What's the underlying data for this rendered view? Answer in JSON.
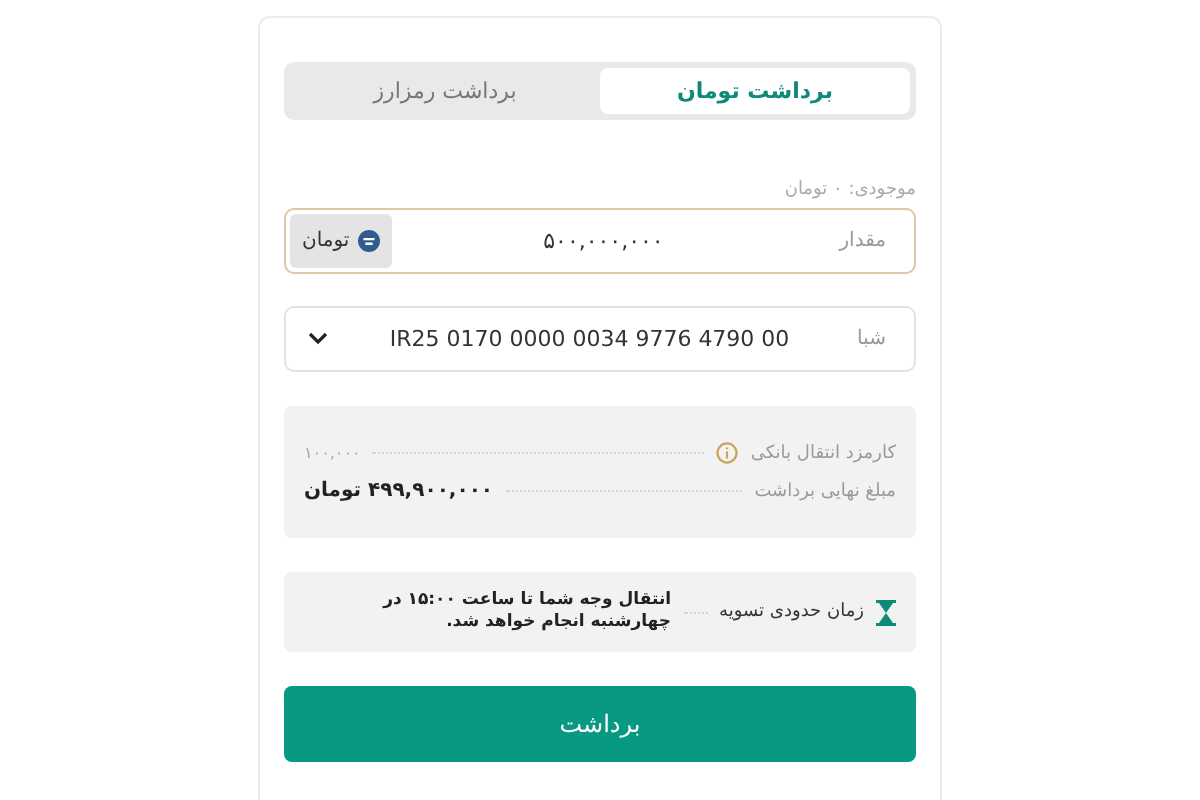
{
  "tabs": [
    {
      "label": "برداشت تومان",
      "selected": true
    },
    {
      "label": "برداشت رمزارز",
      "selected": false
    }
  ],
  "balance": "موجودی: ۰ تومان",
  "amount": {
    "label": "مقدار",
    "value": "۵۰۰,۰۰۰,۰۰۰",
    "currency": "تومان"
  },
  "iban": {
    "label": "شبا",
    "value": "IR25 0170 0000 0034 9776 4790 00"
  },
  "summary": [
    {
      "label": "کارمزد انتقال بانکی",
      "value": "۱۰۰,۰۰۰",
      "kind": "fee"
    },
    {
      "label": "مبلغ نهایی برداشت",
      "value": "۴۹۹,۹۰۰,۰۰۰ تومان",
      "kind": "total"
    }
  ],
  "settlement": {
    "label": "زمان حدودی تسویه",
    "text": "انتقال وجه شما تا ساعت ۱۵:۰۰ در چهارشنبه انجام خواهد شد."
  },
  "submit": "برداشت"
}
